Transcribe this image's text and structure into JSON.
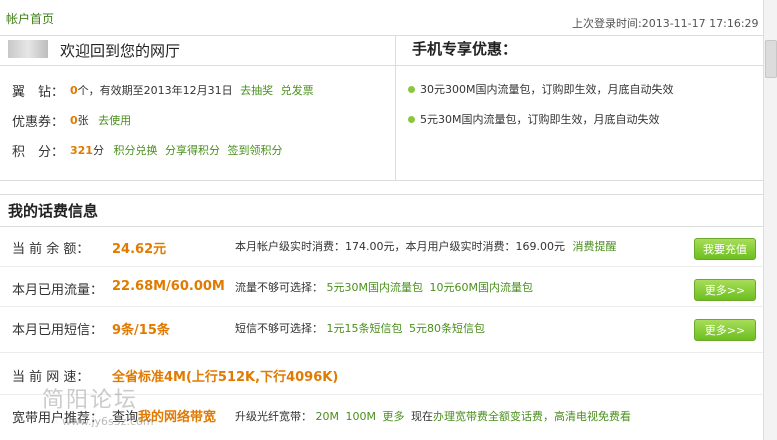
{
  "breadcrumb": "帐户首页",
  "last_login": "上次登录时间:2013-11-17 17:16:29",
  "welcome": {
    "title": "欢迎回到您的网厅"
  },
  "account": {
    "diamond": {
      "label": "翼　钻：",
      "value": "0",
      "suffix": "个，有效期至2013年12月31日",
      "links": [
        "去抽奖",
        "兑发票"
      ]
    },
    "coupon": {
      "label": "优惠券：",
      "value": "0",
      "suffix": "张",
      "links": [
        "去使用"
      ]
    },
    "points": {
      "label": "积　分：",
      "value": "321",
      "suffix": "分",
      "links": [
        "积分兑换",
        "分享得积分",
        "签到领积分"
      ]
    }
  },
  "promo": {
    "title": "手机专享优惠：",
    "items": [
      "30元300M国内流量包，订购即生效，月底自动失效",
      "5元30M国内流量包，订购即生效，月底自动失效"
    ]
  },
  "bill": {
    "title": "我的话费信息",
    "balance": {
      "label": "当 前 余 额：",
      "value": "24.62元",
      "info": "本月帐户级实时消费：174.00元，本月用户级实时消费：169.00元",
      "link": "消费提醒",
      "button": "我要充值"
    },
    "traffic": {
      "label": "本月已用流量：",
      "value": "22.68M/60.00M",
      "info": "流量不够可选择：",
      "links": [
        "5元30M国内流量包",
        "10元60M国内流量包"
      ],
      "button": "更多>>"
    },
    "sms": {
      "label": "本月已用短信：",
      "value": "9条/15条",
      "info": "短信不够可选择：",
      "links": [
        "1元15条短信包",
        "5元80条短信包"
      ],
      "button": "更多>>"
    },
    "speed": {
      "label": "当 前 网 速：",
      "value": "全省标准4M(上行512K,下行4096K)"
    },
    "broadband": {
      "label": "宽带用户推荐：",
      "query_prefix": "查询",
      "query_link": "我的网络带宽",
      "upgrade_prefix": "升级光纤宽带：",
      "links": [
        "20M",
        "100M",
        "更多"
      ],
      "promo_prefix": "现在",
      "promo_link": "办理宽带费全额变话费",
      "promo_suffix": "，高清电视免费看"
    }
  },
  "watermark": {
    "text": "简阳论坛",
    "url": "www.jy6s3z.com"
  }
}
